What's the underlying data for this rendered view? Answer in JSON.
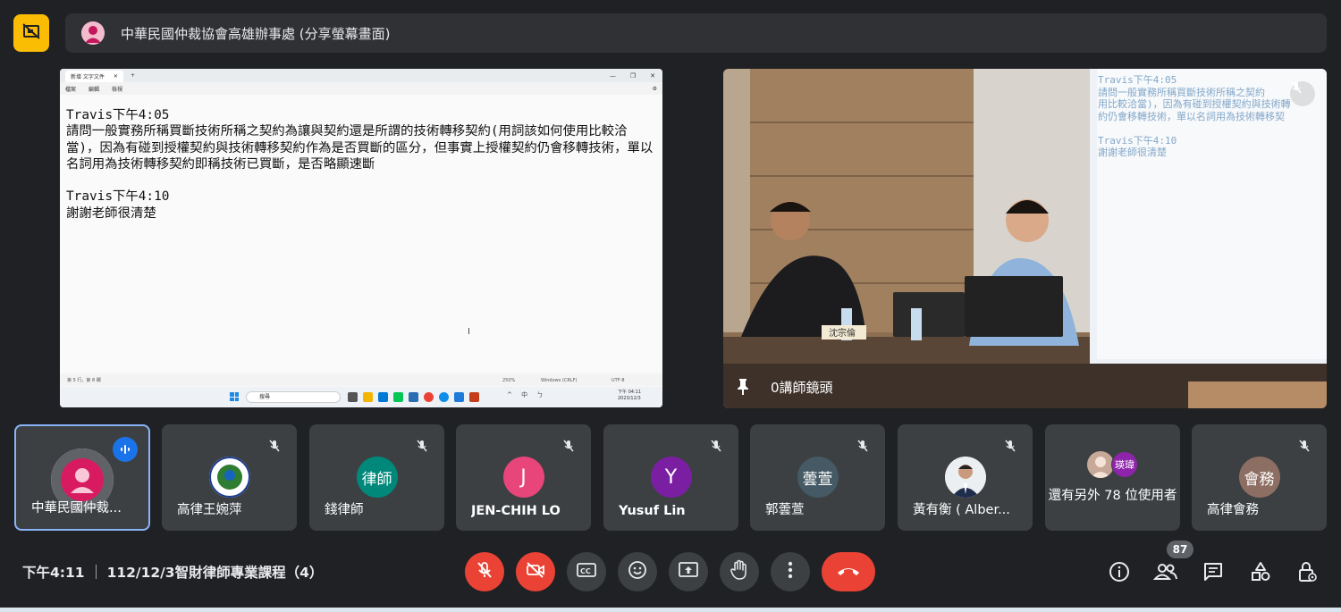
{
  "colors": {
    "accent_yellow": "#fbbc04",
    "danger_red": "#ea4335",
    "active_blue": "#8ab4f8",
    "tile_bg": "#3c4043",
    "bg": "#202124"
  },
  "presenter_bar": {
    "title": "中華民國仲裁協會高雄辦事處 (分享螢幕畫面)",
    "icon": "present-off-icon"
  },
  "shared_screen": {
    "tab_title": "新增 文字文件",
    "menu": [
      "檔案",
      "編輯",
      "檢視"
    ],
    "lines": [
      "Travis下午4:05",
      "請問一般實務所稱買斷技術所稱之契約為讓與契約還是所謂的技術轉移契約(用詞該如何使用比較洽當)，因為有碰到授權契約與技術轉移契約作為是否買斷的區分，但事實上授權契約仍會移轉技術，單以名詞用為技術轉移契約即稱技術已買斷，是否略顯速斷",
      "",
      "Travis下午4:10",
      "謝謝老師很清楚"
    ],
    "status": {
      "position": "第 5 行，第 8 欄",
      "zoom": "250%",
      "eol": "Windows (CRLF)",
      "encoding": "UTF-8"
    },
    "taskbar": {
      "search_placeholder": "搜尋",
      "tray": "^ 中 ㄅ",
      "time": "下午 04:11",
      "date": "2023/12/3"
    }
  },
  "camera_tile": {
    "name": "0講師鏡頭",
    "projection_lines": [
      "Travis下午4:05",
      "請問一般實務所稱買斷技術所稱之契約",
      "用比較洽當)，因為有碰到授權契約與技術轉",
      "約仍會移轉技術，單以名詞用為技術轉移契",
      "",
      "Travis下午4:10",
      "謝謝老師很清楚"
    ],
    "nameplate": "沈宗倫"
  },
  "participants": [
    {
      "name": "中華民國仲裁...",
      "avatar": "",
      "avatar_color": "#c2185b",
      "state": "speaking"
    },
    {
      "name": "高律王婉萍",
      "avatar": "",
      "avatar_color": "#ffffff",
      "state": "muted"
    },
    {
      "name": "錢律師",
      "avatar": "律師",
      "avatar_color": "#00897b",
      "state": "muted"
    },
    {
      "name": "JEN-CHIH LO",
      "avatar": "J",
      "avatar_color": "#e8457a",
      "state": "muted"
    },
    {
      "name": "Yusuf Lin",
      "avatar": "Y",
      "avatar_color": "#7b1fa2",
      "state": "muted"
    },
    {
      "name": "郭蕓萱",
      "avatar": "蕓萱",
      "avatar_color": "#455a64",
      "state": "muted"
    },
    {
      "name": "黃有衡 ( Alber...",
      "avatar": "",
      "avatar_color": "#e0e0e0",
      "state": "muted"
    },
    {
      "name": "還有另外 78 位使用者",
      "avatar": "瑛瑋",
      "avatar_color": "#8e24aa",
      "state": "more"
    },
    {
      "name": "高律會務",
      "avatar": "會務",
      "avatar_color": "#8d6e63",
      "state": "muted"
    }
  ],
  "bottom_bar": {
    "time": "下午4:11",
    "meeting_code": "112/12/3智財律師專業課程（4）",
    "participant_count": "87",
    "controls": [
      "mic-off-icon",
      "camera-off-icon",
      "captions-icon",
      "emoji-icon",
      "present-screen-icon",
      "raise-hand-icon",
      "more-options-icon",
      "end-call-icon"
    ],
    "right_icons": [
      "info-icon",
      "people-icon",
      "chat-icon",
      "activities-icon",
      "host-controls-icon"
    ]
  }
}
